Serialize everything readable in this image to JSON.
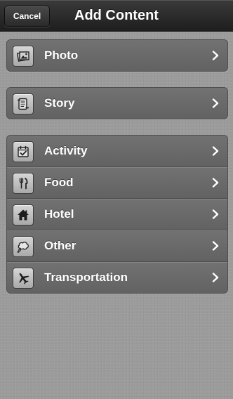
{
  "navbar": {
    "cancel_label": "Cancel",
    "title": "Add Content"
  },
  "groups": [
    {
      "items": [
        {
          "label": "Photo",
          "icon": "photo-icon"
        }
      ]
    },
    {
      "items": [
        {
          "label": "Story",
          "icon": "scroll-icon"
        }
      ]
    },
    {
      "items": [
        {
          "label": "Activity",
          "icon": "calendar-check-icon"
        },
        {
          "label": "Food",
          "icon": "fork-knife-icon"
        },
        {
          "label": "Hotel",
          "icon": "house-icon"
        },
        {
          "label": "Other",
          "icon": "thought-bubble-icon"
        },
        {
          "label": "Transportation",
          "icon": "airplane-icon"
        }
      ]
    }
  ],
  "colors": {
    "background": "#9b9b9b",
    "navbar": "#2a2a2a",
    "row": "#6a6a6a",
    "text": "#ffffff"
  }
}
